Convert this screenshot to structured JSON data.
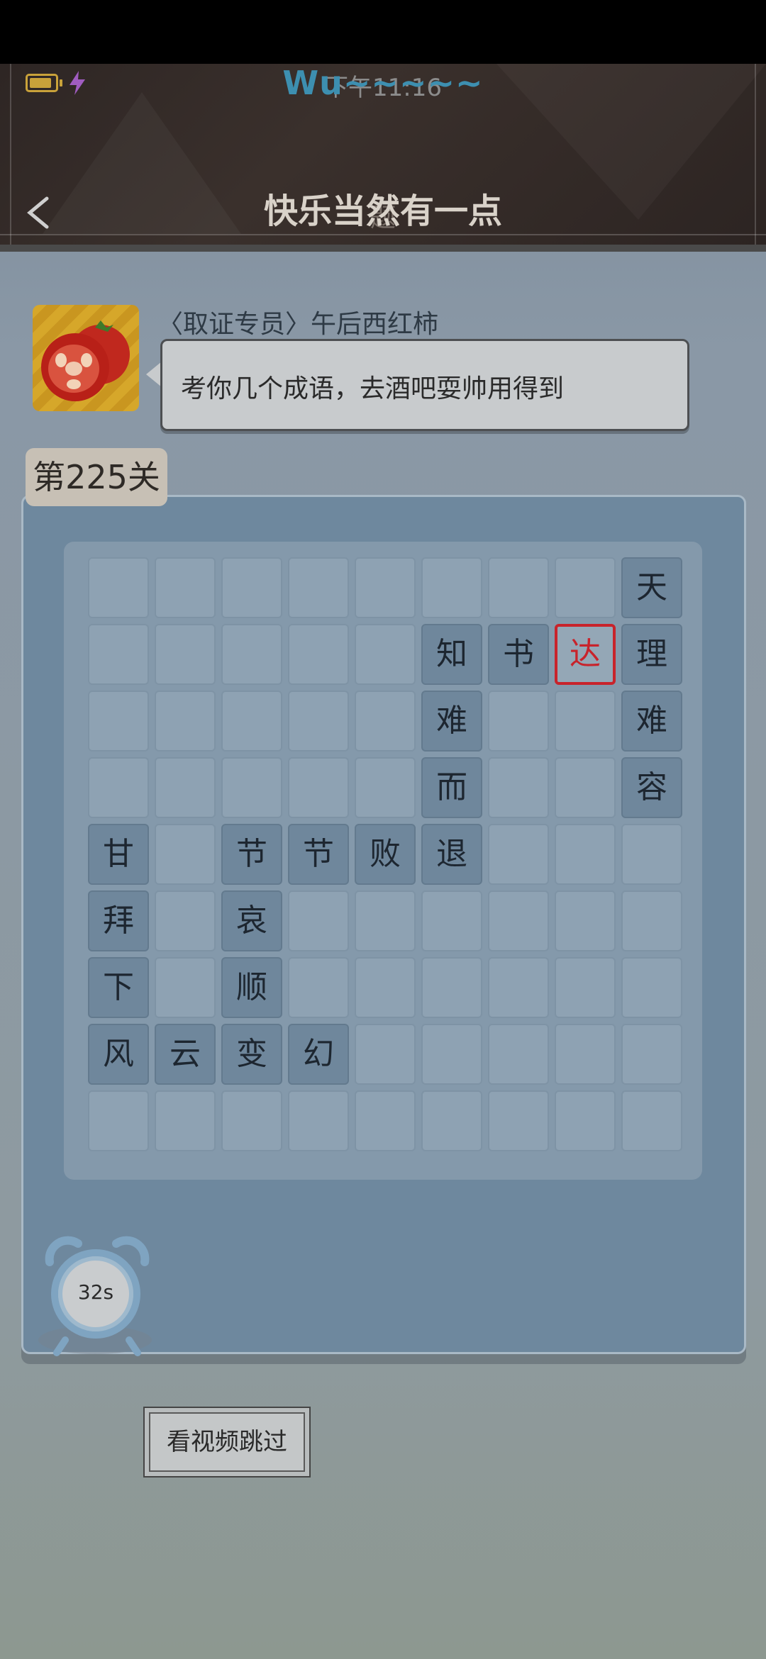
{
  "status": {
    "time": "下午11:16"
  },
  "header": {
    "overlay_title": "Wu~~~~~",
    "title": "快乐当然有一点",
    "title_ghost": "题"
  },
  "npc": {
    "name": "〈取证专员〉午后西红柿",
    "dialogue": "考你几个成语，去酒吧耍帅用得到"
  },
  "level": {
    "label": "第225关"
  },
  "grid": {
    "size": 9,
    "rows": [
      [
        "",
        "",
        "",
        "",
        "",
        "",
        "",
        "",
        "天"
      ],
      [
        "",
        "",
        "",
        "",
        "",
        "知",
        "书",
        "达",
        "理"
      ],
      [
        "",
        "",
        "",
        "",
        "",
        "难",
        "",
        "",
        "难"
      ],
      [
        "",
        "",
        "",
        "",
        "",
        "而",
        "",
        "",
        "容"
      ],
      [
        "甘",
        "",
        "节",
        "节",
        "败",
        "退",
        "",
        "",
        ""
      ],
      [
        "拜",
        "",
        "哀",
        "",
        "",
        "",
        "",
        "",
        ""
      ],
      [
        "下",
        "",
        "顺",
        "",
        "",
        "",
        "",
        "",
        ""
      ],
      [
        "风",
        "云",
        "变",
        "幻",
        "",
        "",
        "",
        "",
        ""
      ],
      [
        "",
        "",
        "",
        "",
        "",
        "",
        "",
        "",
        ""
      ]
    ],
    "active_cell": {
      "row": 1,
      "col": 7
    }
  },
  "timer": {
    "value": "32s"
  },
  "skip_button": {
    "label": "看视频跳过"
  },
  "colors": {
    "active_border": "#c8232b",
    "title": "#d9d2c9",
    "overlay": "#3d8fb0"
  },
  "icons": [
    "battery-icon",
    "charging-bolt-icon",
    "back-arrow-icon",
    "alarm-clock-icon",
    "tomato-avatar"
  ]
}
